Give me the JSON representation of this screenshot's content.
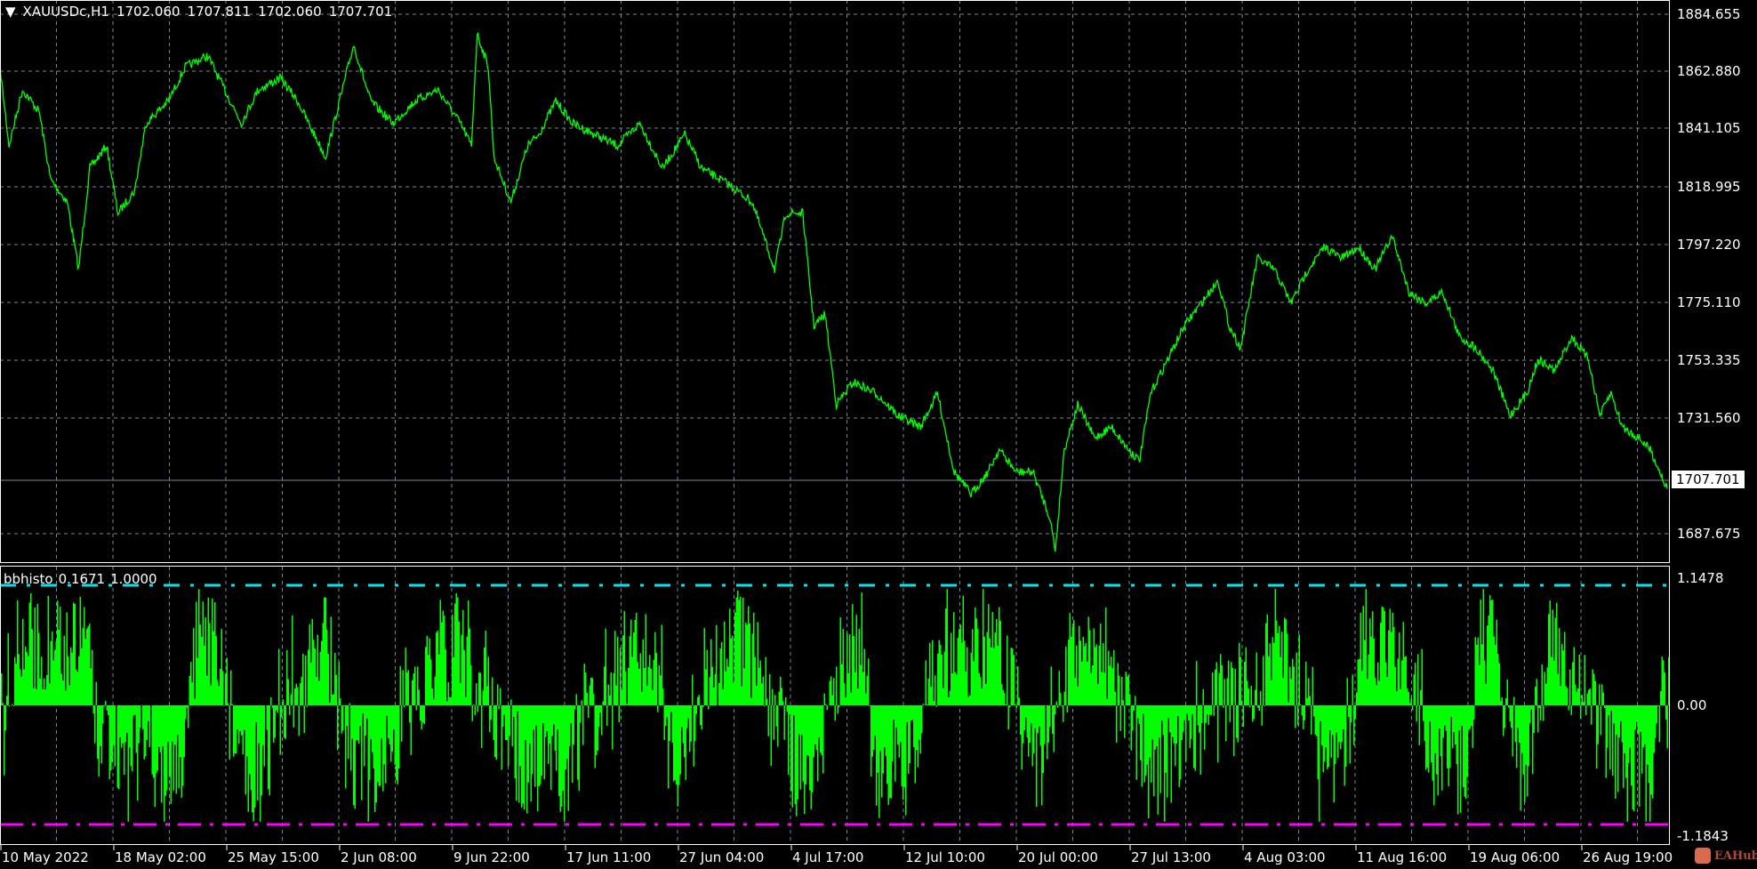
{
  "header": {
    "symbol": "XAUUSDc,H1",
    "open": "1702.060",
    "high": "1707.811",
    "low": "1702.060",
    "close": "1707.701"
  },
  "indicator": {
    "name": "bbhisto",
    "value1": "0.1671",
    "value2": "1.0000"
  },
  "price_axis": [
    "1884.655",
    "1862.880",
    "1841.105",
    "1818.995",
    "1797.220",
    "1775.110",
    "1753.335",
    "1731.560",
    "1687.675"
  ],
  "current_price": "1707.701",
  "indicator_axis": [
    "1.1478",
    "0.00",
    "-1.1843"
  ],
  "time_axis": [
    "10 May 2022",
    "18 May 02:00",
    "25 May 15:00",
    "2 Jun 08:00",
    "9 Jun 22:00",
    "17 Jun 11:00",
    "27 Jun 04:00",
    "4 Jul 17:00",
    "12 Jul 10:00",
    "20 Jul 00:00",
    "27 Jul 13:00",
    "4 Aug 03:00",
    "11 Aug 16:00",
    "19 Aug 06:00",
    "26 Aug 19:00"
  ],
  "logo": "EAHub",
  "colors": {
    "price": "#00ff00",
    "histogram": "#00ff00",
    "upper": "#00e5ee",
    "lower": "#ff00ff",
    "grid": "#778899"
  },
  "chart_data": {
    "type": "line",
    "title": "XAUUSDc,H1",
    "ylim": [
      1687.675,
      1884.655
    ],
    "x": [
      0,
      8,
      20,
      35,
      45,
      60,
      70,
      80,
      95,
      105,
      120,
      130,
      150,
      165,
      185,
      200,
      215,
      230,
      250,
      265,
      280,
      290,
      300,
      315,
      330,
      350,
      370,
      390,
      410,
      420,
      425,
      435,
      440,
      455,
      470,
      480,
      495,
      510,
      530,
      550,
      570,
      590,
      610,
      625,
      650,
      670,
      690,
      700,
      715,
      725,
      735,
      745,
      760,
      780,
      800,
      820,
      835,
      850,
      865,
      880,
      890,
      905,
      920,
      935,
      940,
      948,
      960,
      975,
      990,
      1005,
      1015,
      1025,
      1040,
      1055,
      1070,
      1085,
      1095,
      1105,
      1120,
      1135,
      1150,
      1165,
      1180,
      1195,
      1210,
      1225,
      1240,
      1255,
      1270,
      1285,
      1300,
      1315,
      1330,
      1345,
      1360,
      1370,
      1385,
      1400,
      1415,
      1425,
      1435,
      1445,
      1460,
      1470,
      1485
    ],
    "y": [
      1864.6,
      1834.8,
      1856.1,
      1847.6,
      1822.0,
      1813.4,
      1787.9,
      1826.2,
      1834.8,
      1809.2,
      1817.7,
      1843.3,
      1851.8,
      1864.6,
      1868.9,
      1856.1,
      1843.3,
      1856.1,
      1860.4,
      1851.8,
      1839.0,
      1830.5,
      1847.6,
      1873.1,
      1851.8,
      1843.3,
      1851.8,
      1856.1,
      1843.3,
      1834.8,
      1877.4,
      1864.6,
      1830.5,
      1813.4,
      1834.8,
      1839.0,
      1851.8,
      1843.3,
      1839.0,
      1834.8,
      1843.3,
      1826.2,
      1839.0,
      1826.2,
      1819.9,
      1813.4,
      1787.9,
      1809.2,
      1809.2,
      1766.5,
      1770.8,
      1736.7,
      1745.2,
      1741.0,
      1732.4,
      1728.2,
      1741.0,
      1711.1,
      1702.6,
      1711.1,
      1719.6,
      1711.1,
      1711.1,
      1694.1,
      1681.3,
      1719.6,
      1736.7,
      1723.9,
      1728.2,
      1719.6,
      1715.4,
      1741.0,
      1753.7,
      1766.5,
      1775.1,
      1783.6,
      1766.5,
      1758.0,
      1792.1,
      1787.9,
      1775.1,
      1787.9,
      1796.4,
      1792.1,
      1796.4,
      1787.9,
      1800.7,
      1779.3,
      1775.1,
      1779.3,
      1762.3,
      1758.0,
      1749.5,
      1732.4,
      1741.0,
      1753.7,
      1749.5,
      1762.3,
      1753.7,
      1732.4,
      1741.0,
      1728.2,
      1723.9,
      1719.6,
      1704.7
    ]
  }
}
